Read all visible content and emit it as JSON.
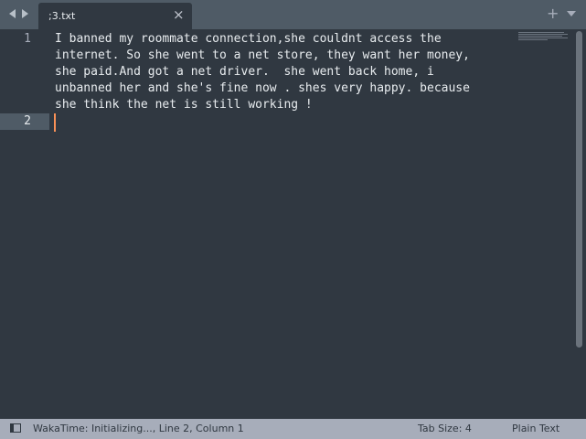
{
  "tabbar": {
    "tab_title": ";3.txt",
    "close_glyph": "×",
    "add_glyph": "+",
    "icons": [
      "chevron-left-icon",
      "chevron-right-icon",
      "close-icon",
      "plus-icon",
      "chevron-down-icon"
    ]
  },
  "editor": {
    "line_numbers": [
      "1",
      "2"
    ],
    "lines": [
      "I banned my roommate connection,she couldnt access the\ninternet. So she went to a net store, they want her money,\nshe paid.And got a net driver.  she went back home, i\nunbanned her and she's fine now . shes very happy. because\nshe think the net is still working !",
      ""
    ],
    "current_line": 2
  },
  "statusbar": {
    "status": "WakaTime: Initializing..., Line 2, Column 1",
    "tab_size": "Tab Size: 4",
    "syntax": "Plain Text"
  },
  "colors": {
    "background": "#303841",
    "tabbar": "#4f5b66",
    "statusbar": "#a7adba",
    "caret": "#f99157",
    "text": "#e8ecef"
  }
}
